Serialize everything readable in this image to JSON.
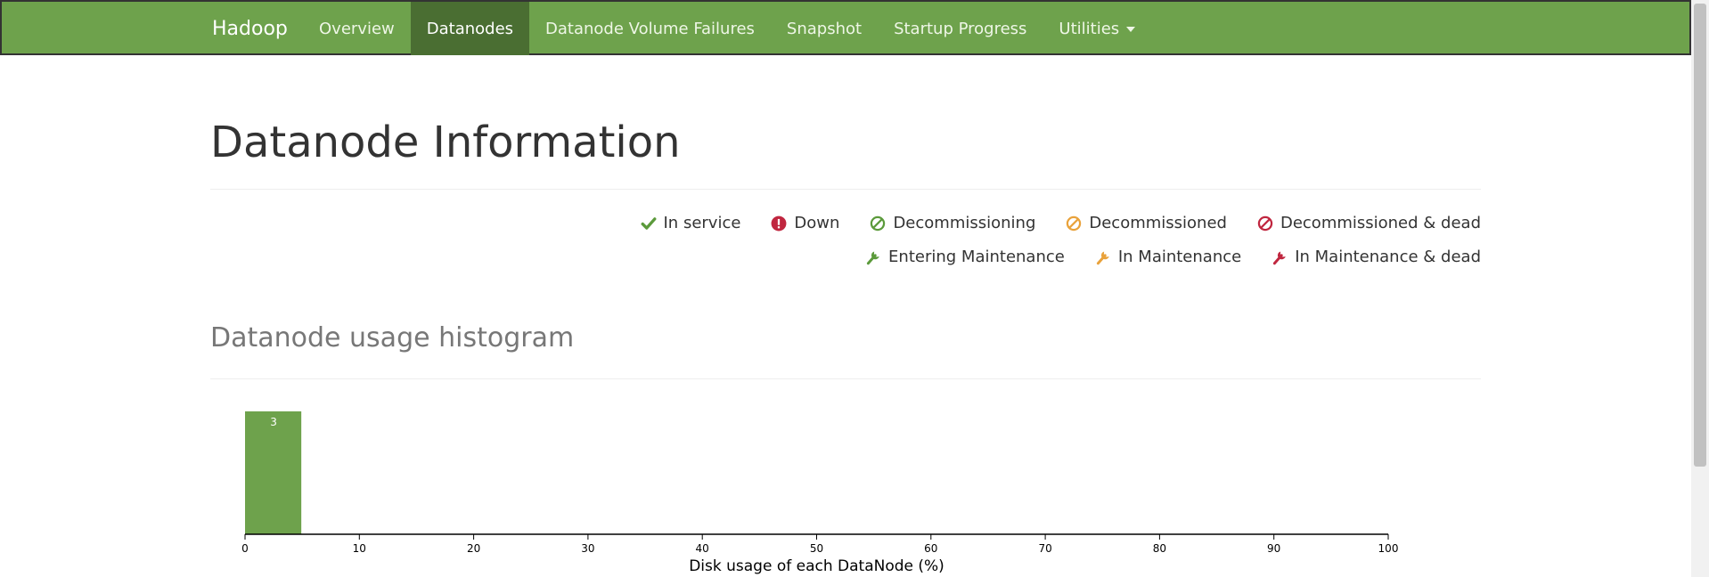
{
  "navbar": {
    "brand": "Hadoop",
    "items": [
      {
        "label": "Overview",
        "active": false
      },
      {
        "label": "Datanodes",
        "active": true
      },
      {
        "label": "Datanode Volume Failures",
        "active": false
      },
      {
        "label": "Snapshot",
        "active": false
      },
      {
        "label": "Startup Progress",
        "active": false
      },
      {
        "label": "Utilities",
        "active": false,
        "dropdown": true
      }
    ]
  },
  "page": {
    "title": "Datanode Information"
  },
  "legend": {
    "row1": [
      {
        "label": "In service",
        "icon": "check-icon",
        "color": "#5b9a3b"
      },
      {
        "label": "Down",
        "icon": "exclamation-circle-icon",
        "color": "#c0263f"
      },
      {
        "label": "Decommissioning",
        "icon": "ban-icon",
        "color": "#5b9a3b"
      },
      {
        "label": "Decommissioned",
        "icon": "ban-icon",
        "color": "#e9a23b"
      },
      {
        "label": "Decommissioned & dead",
        "icon": "ban-icon",
        "color": "#c0263f"
      }
    ],
    "row2": [
      {
        "label": "Entering Maintenance",
        "icon": "wrench-icon",
        "color": "#5b9a3b"
      },
      {
        "label": "In Maintenance",
        "icon": "wrench-icon",
        "color": "#e9a23b"
      },
      {
        "label": "In Maintenance & dead",
        "icon": "wrench-icon",
        "color": "#c0263f"
      }
    ]
  },
  "histogram": {
    "title": "Datanode usage histogram"
  },
  "chart_data": {
    "type": "bar",
    "title": "",
    "xlabel": "Disk usage of each DataNode (%)",
    "ylabel": "",
    "xlim": [
      0,
      100
    ],
    "xticks": [
      0,
      10,
      20,
      30,
      40,
      50,
      60,
      70,
      80,
      90,
      100
    ],
    "bins": [
      {
        "x0": 0,
        "x1": 5,
        "count": 3,
        "label": "3"
      }
    ],
    "bar_color": "#6ea24c",
    "grid": false
  }
}
